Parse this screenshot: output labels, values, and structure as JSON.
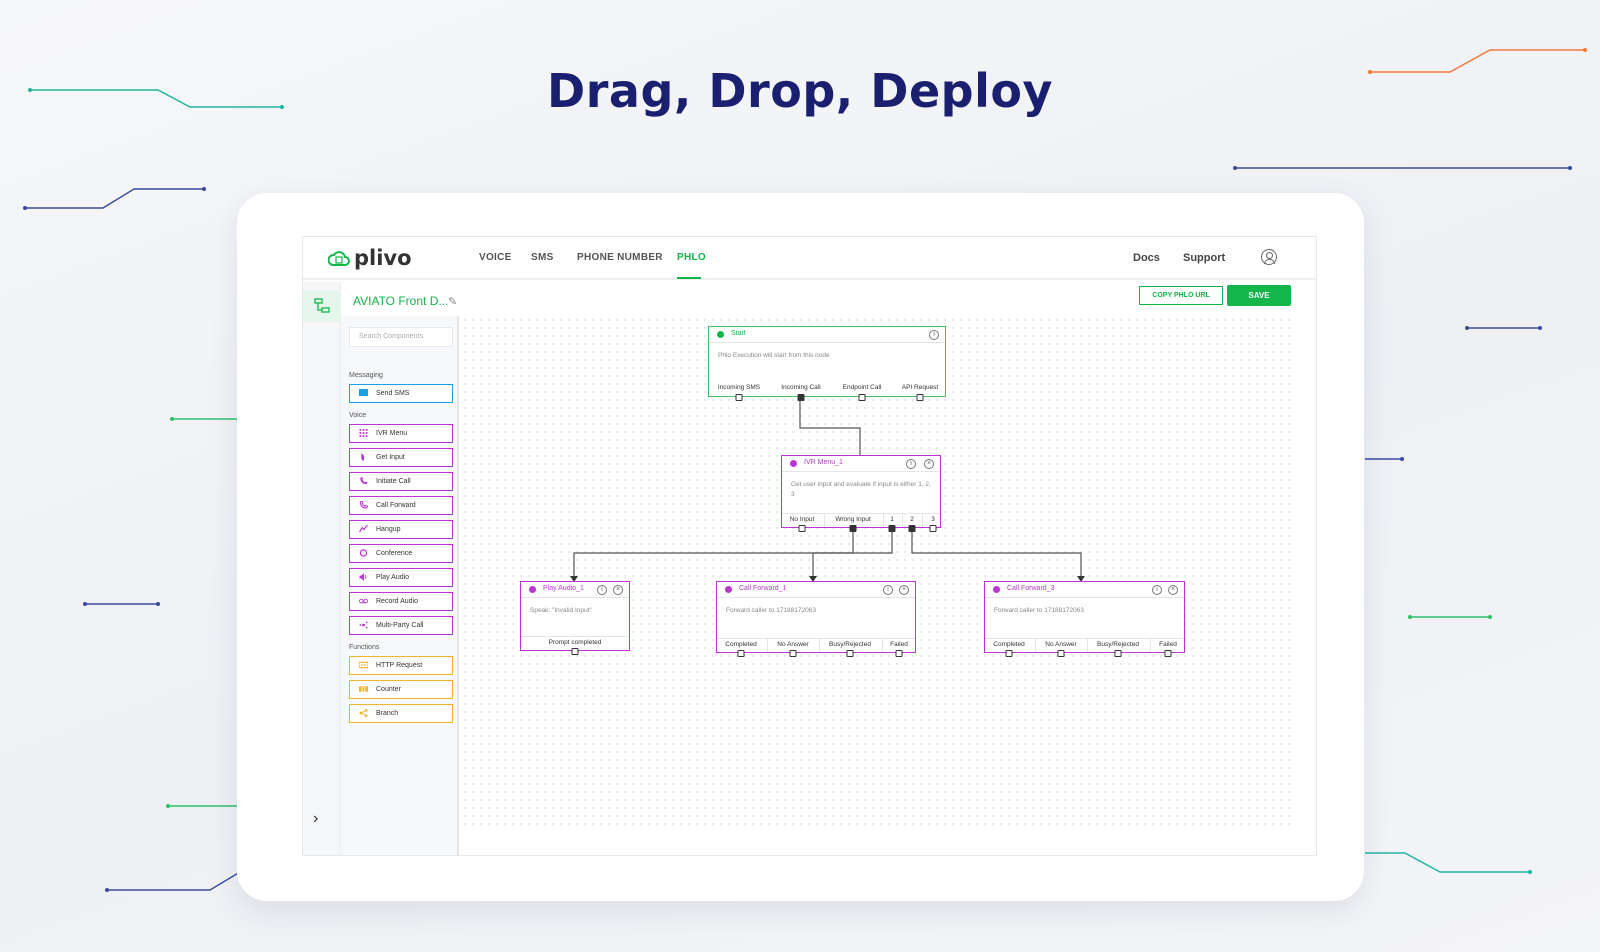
{
  "hero": {
    "title": "Drag, Drop, Deploy"
  },
  "colors": {
    "brand_green": "#13b64a",
    "voice_purple": "#bb35d4",
    "messaging_blue": "#1aa1e3",
    "functions_amber": "#f2b42a",
    "hero_navy": "#1b1f6f"
  },
  "app": {
    "logo": "plivo",
    "nav_tabs": [
      {
        "label": "VOICE",
        "active": false
      },
      {
        "label": "SMS",
        "active": false
      },
      {
        "label": "PHONE NUMBER",
        "active": false
      },
      {
        "label": "PHLO",
        "active": true
      }
    ],
    "nav_right": {
      "docs": "Docs",
      "support": "Support",
      "icon": "user-account-icon"
    },
    "phlo_name": "AVIATO Front D...",
    "buttons": {
      "copy_url": "COPY PHLO URL",
      "save": "SAVE"
    },
    "palette": {
      "search_placeholder": "Search Components",
      "sections": [
        {
          "title": "Messaging",
          "items": [
            {
              "label": "Send SMS",
              "icon": "sms-icon"
            }
          ]
        },
        {
          "title": "Voice",
          "items": [
            {
              "label": "IVR Menu",
              "icon": "keypad-icon"
            },
            {
              "label": "Get Input",
              "icon": "input-icon"
            },
            {
              "label": "Initiate Call",
              "icon": "phone-icon"
            },
            {
              "label": "Call Forward",
              "icon": "call-forward-icon"
            },
            {
              "label": "Hangup",
              "icon": "hangup-icon"
            },
            {
              "label": "Conference",
              "icon": "conference-icon"
            },
            {
              "label": "Play Audio",
              "icon": "speaker-icon"
            },
            {
              "label": "Record Audio",
              "icon": "record-icon"
            },
            {
              "label": "Multi-Party Call",
              "icon": "multi-party-icon"
            }
          ]
        },
        {
          "title": "Functions",
          "items": [
            {
              "label": "HTTP Request",
              "icon": "http-icon"
            },
            {
              "label": "Counter",
              "icon": "counter-icon"
            },
            {
              "label": "Branch",
              "icon": "branch-icon"
            }
          ]
        }
      ]
    },
    "nodes": {
      "start": {
        "title": "Start",
        "desc": "Phlo Execution will start from this node",
        "ports": [
          "Incoming SMS",
          "Incoming Call",
          "Endpoint Call",
          "API Request"
        ]
      },
      "ivr": {
        "title": "IVR Menu_1",
        "desc": "Get user input and evaluate if input is either 1, 2, 3",
        "ports": [
          "No Input",
          "Wrong Input",
          "1",
          "2",
          "3"
        ]
      },
      "play": {
        "title": "Play Audio_1",
        "desc": "Speak: \"Invalid Input\"",
        "ports": [
          "Prompt completed"
        ]
      },
      "cf1": {
        "title": "Call Forward_1",
        "desc": "Forward caller to 17188172063",
        "ports": [
          "Completed",
          "No Answer",
          "Busy/Rejected",
          "Failed"
        ]
      },
      "cf3": {
        "title": "Call Forward_3",
        "desc": "Forward caller to 17188172063",
        "ports": [
          "Completed",
          "No Answer",
          "Busy/Rejected",
          "Failed"
        ]
      }
    }
  }
}
